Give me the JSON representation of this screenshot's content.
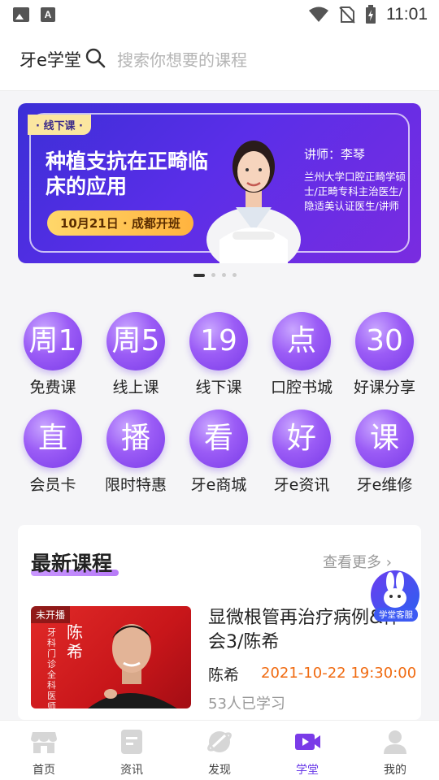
{
  "status_bar": {
    "time": "11:01"
  },
  "header": {
    "brand": "牙e学堂",
    "search_placeholder": "搜索你想要的课程"
  },
  "banner": {
    "tag": "· 线下课 ·",
    "title": "种植支抗在正畸临床的应用",
    "date_pill": "10月21日 · 成都开班",
    "lecturer": "讲师：李琴",
    "lecturer_desc": "兰州大学口腔正畸学硕士/正畸专科主治医生/隐适美认证医生/讲师",
    "slide_count": 4,
    "active_slide": 1
  },
  "categories": [
    {
      "glyph": "周1",
      "label": "免费课"
    },
    {
      "glyph": "周5",
      "label": "线上课"
    },
    {
      "glyph": "19",
      "label": "线下课"
    },
    {
      "glyph": "点",
      "label": "口腔书城"
    },
    {
      "glyph": "30",
      "label": "好课分享"
    },
    {
      "glyph": "直",
      "label": "会员卡"
    },
    {
      "glyph": "播",
      "label": "限时特惠"
    },
    {
      "glyph": "看",
      "label": "牙e商城"
    },
    {
      "glyph": "好",
      "label": "牙e资讯"
    },
    {
      "glyph": "课",
      "label": "牙e维修"
    }
  ],
  "latest": {
    "title": "最新课程",
    "more": "查看更多",
    "course": {
      "thumb_badge": "未开播",
      "thumb_name": "陈希",
      "thumb_sub": "牙科门诊全科医师",
      "title": "显微根管再治疗病例&体会3/陈希",
      "teacher": "陈希",
      "time": "2021-10-22 19:30:00",
      "learners": "53人已学习"
    }
  },
  "service": {
    "label": "学堂客服"
  },
  "tabs": [
    {
      "label": "首页",
      "icon": "store-icon"
    },
    {
      "label": "资讯",
      "icon": "news-icon"
    },
    {
      "label": "发现",
      "icon": "discover-icon"
    },
    {
      "label": "学堂",
      "icon": "video-icon",
      "active": true
    },
    {
      "label": "我的",
      "icon": "profile-icon"
    }
  ],
  "colors": {
    "accent": "#6a3be8",
    "orange": "#f06a10",
    "banner_start": "#3b2fd6"
  }
}
